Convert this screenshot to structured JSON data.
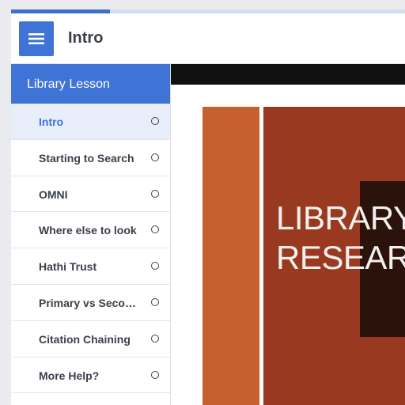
{
  "progress": {
    "fraction": 0.25
  },
  "header": {
    "menu_icon": "hamburger-menu-icon",
    "title": "Intro"
  },
  "sidebar": {
    "title": "Library Lesson",
    "items": [
      {
        "label": "Intro",
        "active": true,
        "status_icon": "circle-outline-icon"
      },
      {
        "label": "Starting to Search",
        "active": false,
        "status_icon": "circle-outline-icon"
      },
      {
        "label": "OMNI",
        "active": false,
        "status_icon": "circle-outline-icon"
      },
      {
        "label": "Where else to look",
        "active": false,
        "status_icon": "circle-outline-icon"
      },
      {
        "label": "Hathi Trust",
        "active": false,
        "status_icon": "circle-outline-icon"
      },
      {
        "label": "Primary vs Secondary",
        "active": false,
        "status_icon": "circle-outline-icon"
      },
      {
        "label": "Citation Chaining",
        "active": false,
        "status_icon": "circle-outline-icon"
      },
      {
        "label": "More Help?",
        "active": false,
        "status_icon": "circle-outline-icon"
      }
    ]
  },
  "slide": {
    "title_lines": [
      "LIBRARY",
      "RESEARCH"
    ]
  },
  "colors": {
    "accent": "#3f73d6",
    "slide_orange": "#c6602d",
    "slide_rust": "#993a20",
    "slide_dark": "#2b120a"
  }
}
